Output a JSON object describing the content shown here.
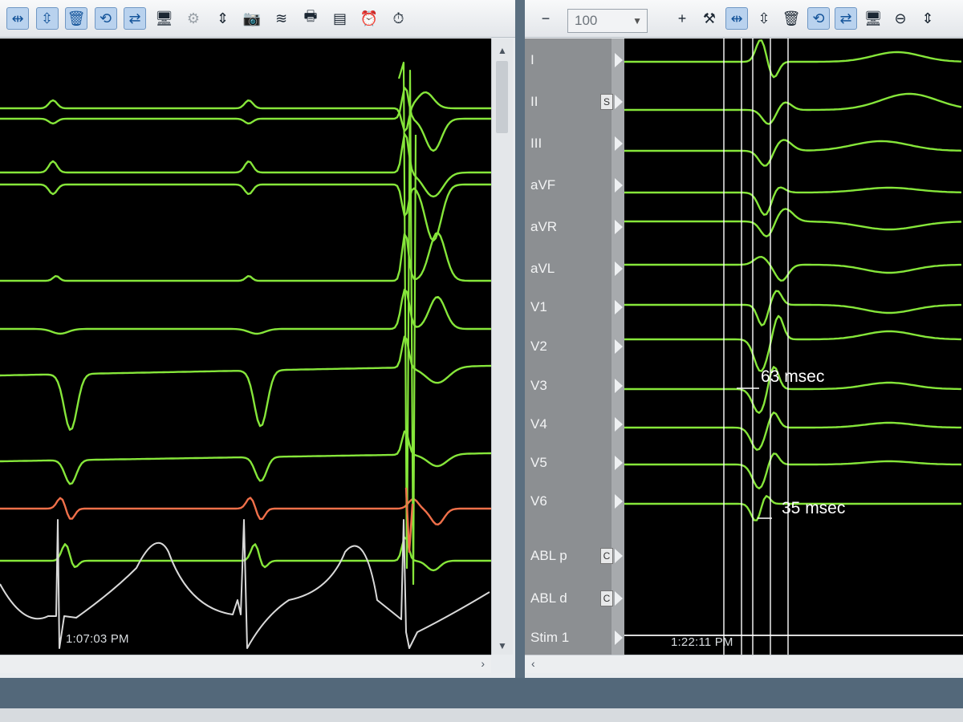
{
  "left_panel": {
    "toolbar": [
      {
        "name": "fit-horizontal-icon",
        "glyph": "⇹",
        "active": true
      },
      {
        "name": "fit-vertical-icon",
        "glyph": "⇳",
        "active": true
      },
      {
        "name": "trash-icon",
        "glyph": "🗑",
        "active": true
      },
      {
        "name": "cycle-icon",
        "glyph": "⟲",
        "active": true
      },
      {
        "name": "swap-icon",
        "glyph": "⇄",
        "active": true
      },
      {
        "name": "monitor-icon",
        "glyph": "🖥",
        "active": false
      },
      {
        "name": "gear-disabled-icon",
        "glyph": "⚙",
        "active": false,
        "disabled": true
      },
      {
        "name": "up-down-icon",
        "glyph": "⇕",
        "active": false
      },
      {
        "name": "camera-icon",
        "glyph": "📷",
        "active": false
      },
      {
        "name": "waveform-print-icon",
        "glyph": "≋",
        "active": false
      },
      {
        "name": "printer-icon",
        "glyph": "🖶",
        "active": false
      },
      {
        "name": "report-icon",
        "glyph": "▤",
        "active": false
      },
      {
        "name": "alarm-clock-icon",
        "glyph": "⏰",
        "active": false
      },
      {
        "name": "stopwatch-icon",
        "glyph": "⏱",
        "active": false
      }
    ],
    "timestamp": "1:07:03 PM"
  },
  "right_panel": {
    "toolbar": [
      {
        "name": "zoom-out-icon",
        "glyph": "−",
        "active": false
      },
      {
        "name": "zoom-in-icon",
        "glyph": "+",
        "active": false
      },
      {
        "name": "tools-icon",
        "glyph": "⚒",
        "active": false
      },
      {
        "name": "fit-horizontal-icon",
        "glyph": "⇹",
        "active": true
      },
      {
        "name": "fit-vertical-icon",
        "glyph": "⇳",
        "active": false
      },
      {
        "name": "trash-icon",
        "glyph": "🗑",
        "active": false
      },
      {
        "name": "cycle-icon",
        "glyph": "⟲",
        "active": true
      },
      {
        "name": "swap-icon",
        "glyph": "⇄",
        "active": true
      },
      {
        "name": "monitor-icon",
        "glyph": "🖥",
        "active": false
      },
      {
        "name": "reset-icon",
        "glyph": "⊖",
        "active": false
      },
      {
        "name": "up-down-icon",
        "glyph": "⇕",
        "active": false
      }
    ],
    "zoom_value": "100",
    "channels": [
      {
        "label": "I"
      },
      {
        "label": "II",
        "badge": "S"
      },
      {
        "label": "III"
      },
      {
        "label": "aVF"
      },
      {
        "label": "aVR"
      },
      {
        "label": "aVL"
      },
      {
        "label": "V1"
      },
      {
        "label": "V2"
      },
      {
        "label": "V3"
      },
      {
        "label": "V4"
      },
      {
        "label": "V5"
      },
      {
        "label": "V6"
      },
      {
        "label": "ABL p",
        "badge": "C"
      },
      {
        "label": "ABL d",
        "badge": "C"
      },
      {
        "label": "Stim 1"
      }
    ],
    "measurement_1": "63 msec",
    "measurement_2": "35 msec",
    "timestamp": "1:22:11 PM"
  },
  "colors": {
    "trace_green": "#86e63a",
    "trace_orange": "#f0704a",
    "trace_white": "#d9d9d9",
    "background": "#000000"
  }
}
